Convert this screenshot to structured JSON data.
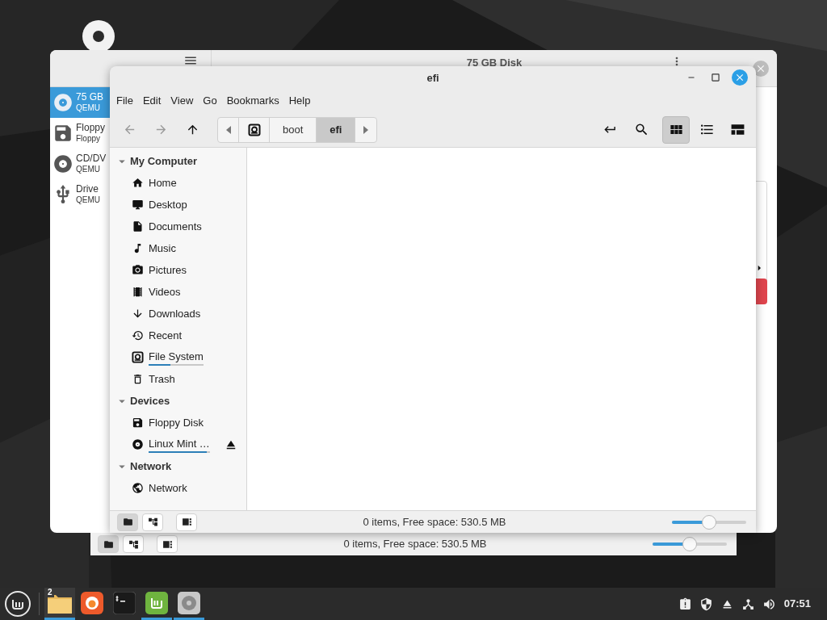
{
  "disks_window": {
    "title": "75 GB Disk",
    "drives": [
      {
        "kind": "hdd",
        "name": "75 GB",
        "model": "QEMU",
        "selected": true
      },
      {
        "kind": "floppy",
        "name": "Floppy",
        "model": "Floppy",
        "selected": false
      },
      {
        "kind": "cd",
        "name": "CD/DV",
        "model": "QEMU",
        "selected": false
      },
      {
        "kind": "usb",
        "name": "Drive",
        "model": "QEMU",
        "selected": false
      }
    ]
  },
  "back_files_window": {
    "status": "0 items, Free space: 530.5 MB",
    "pane_buttons": [
      {
        "kind": "places",
        "selected": true
      },
      {
        "kind": "tree",
        "selected": false
      },
      {
        "kind": "toggle",
        "selected": false
      }
    ],
    "zoom": {
      "level": 0.5
    }
  },
  "files_window": {
    "title": "efi",
    "menu": [
      "File",
      "Edit",
      "View",
      "Go",
      "Bookmarks",
      "Help"
    ],
    "nav": [
      {
        "kind": "back",
        "disabled": true
      },
      {
        "kind": "forward",
        "disabled": true
      },
      {
        "kind": "up",
        "disabled": false
      }
    ],
    "path": [
      {
        "label": "boot",
        "selected": false
      },
      {
        "label": "efi",
        "selected": true
      }
    ],
    "view_modes": [
      {
        "kind": "icons",
        "selected": true
      },
      {
        "kind": "list",
        "selected": false
      },
      {
        "kind": "compact",
        "selected": false
      }
    ],
    "sidebar": [
      {
        "title": "My Computer",
        "expanded": true,
        "items": [
          {
            "kind": "home",
            "label": "Home"
          },
          {
            "kind": "desktop",
            "label": "Desktop"
          },
          {
            "kind": "documents",
            "label": "Documents"
          },
          {
            "kind": "music",
            "label": "Music"
          },
          {
            "kind": "pictures",
            "label": "Pictures"
          },
          {
            "kind": "videos",
            "label": "Videos"
          },
          {
            "kind": "downloads",
            "label": "Downloads"
          },
          {
            "kind": "recent",
            "label": "Recent"
          },
          {
            "kind": "filesystem",
            "label": "File System",
            "level": 0.4
          },
          {
            "kind": "trash",
            "label": "Trash"
          }
        ]
      },
      {
        "title": "Devices",
        "expanded": true,
        "items": [
          {
            "kind": "floppy",
            "label": "Floppy Disk"
          },
          {
            "kind": "disc",
            "label": "Linux Mint …",
            "level": 0.95,
            "ejectable": true
          }
        ]
      },
      {
        "title": "Network",
        "expanded": true,
        "items": [
          {
            "kind": "network",
            "label": "Network"
          }
        ]
      }
    ],
    "status": "0 items, Free space: 530.5 MB",
    "pane_buttons": [
      {
        "kind": "places",
        "selected": true
      },
      {
        "kind": "tree",
        "selected": false
      },
      {
        "kind": "toggle",
        "selected": false
      }
    ],
    "zoom": {
      "level": 0.5
    }
  },
  "taskbar": {
    "apps": [
      {
        "kind": "files",
        "badge": "2",
        "running": true
      },
      {
        "kind": "firefox",
        "running": false
      },
      {
        "kind": "terminal",
        "running": false
      },
      {
        "kind": "update",
        "running": true
      },
      {
        "kind": "disks",
        "running": true
      }
    ],
    "tray": [
      {
        "kind": "clipboard"
      },
      {
        "kind": "shield"
      },
      {
        "kind": "eject"
      },
      {
        "kind": "network"
      },
      {
        "kind": "volume"
      }
    ],
    "clock": "07:51"
  }
}
